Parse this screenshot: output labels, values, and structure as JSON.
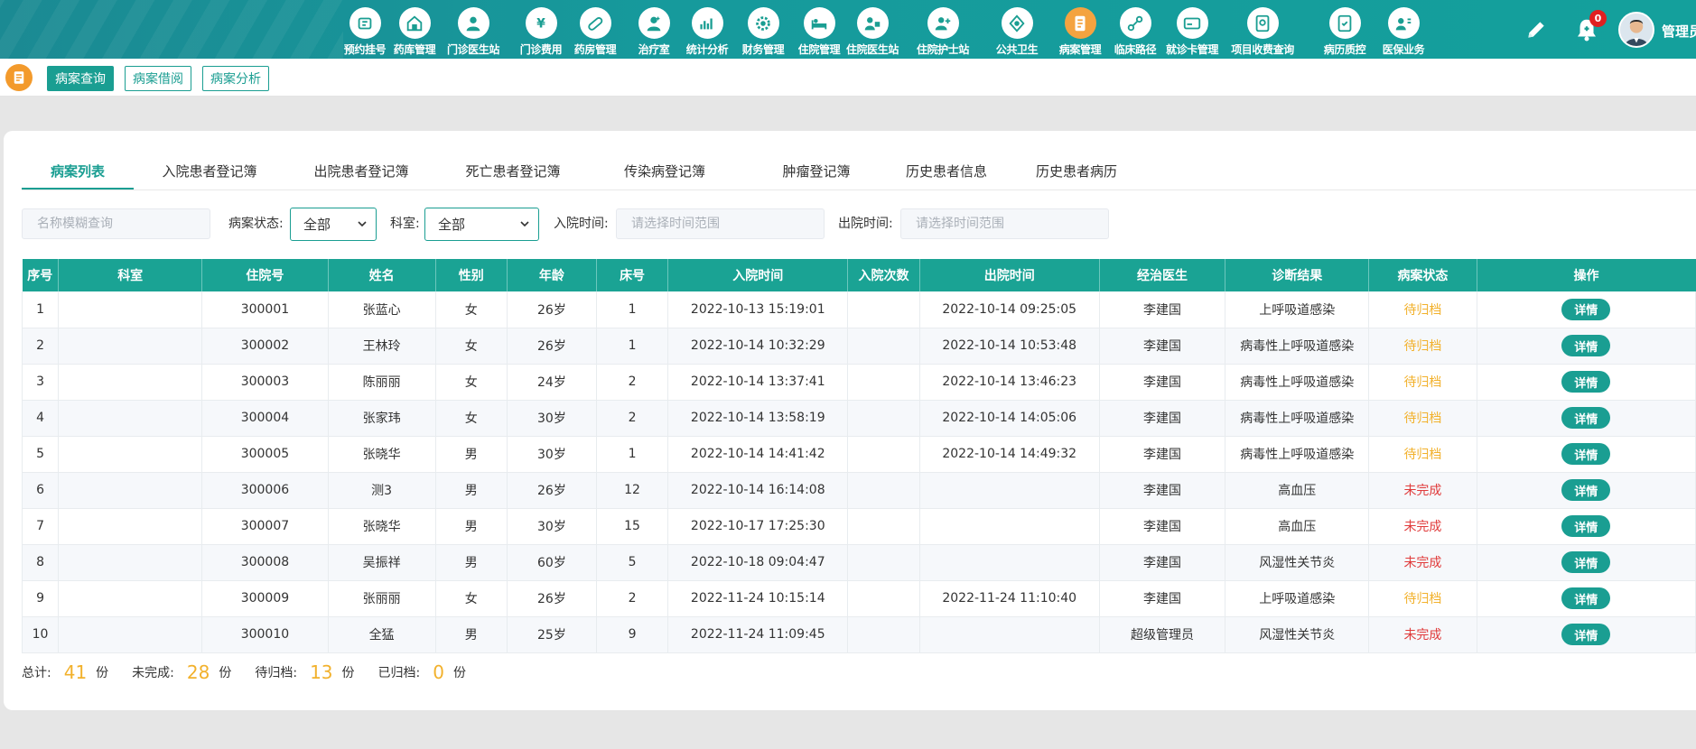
{
  "nav": {
    "items": [
      {
        "label": "预约挂号",
        "icon": "register-icon"
      },
      {
        "label": "药库管理",
        "icon": "warehouse-icon"
      },
      {
        "label": "门诊医生站",
        "icon": "doctor-icon"
      },
      {
        "label": "门诊费用",
        "icon": "yuan-icon"
      },
      {
        "label": "药房管理",
        "icon": "pill-icon"
      },
      {
        "label": "治疗室",
        "icon": "nurse-icon"
      },
      {
        "label": "统计分析",
        "icon": "chart-icon"
      },
      {
        "label": "财务管理",
        "icon": "finance-gear-icon"
      },
      {
        "label": "住院管理",
        "icon": "inpatient-icon"
      },
      {
        "label": "住院医生站",
        "icon": "inpatient-doctor-icon"
      },
      {
        "label": "住院护士站",
        "icon": "nurse-station-icon"
      },
      {
        "label": "公共卫生",
        "icon": "public-health-icon"
      },
      {
        "label": "病案管理",
        "icon": "medical-record-icon",
        "active": true
      },
      {
        "label": "临床路径",
        "icon": "clinical-path-icon"
      },
      {
        "label": "就诊卡管理",
        "icon": "card-icon"
      },
      {
        "label": "项目收费查询",
        "icon": "fee-query-icon"
      },
      {
        "label": "病历质控",
        "icon": "quality-control-icon"
      },
      {
        "label": "医保业务",
        "icon": "insurance-icon"
      }
    ],
    "notification_count": "0",
    "username": "管理员"
  },
  "subbar": {
    "tabs": [
      "病案查询",
      "病案借阅",
      "病案分析"
    ]
  },
  "tabs": [
    "病案列表",
    "入院患者登记簿",
    "出院患者登记簿",
    "死亡患者登记簿",
    "传染病登记簿",
    "肿瘤登记簿",
    "历史患者信息",
    "历史患者病历"
  ],
  "filters": {
    "name_placeholder": "名称模糊查询",
    "status_label": "病案状态:",
    "status_value": "全部",
    "dept_label": "科室:",
    "dept_value": "全部",
    "admit_label": "入院时间:",
    "admit_placeholder": "请选择时间范围",
    "discharge_label": "出院时间:",
    "discharge_placeholder": "请选择时间范围"
  },
  "table": {
    "headers": [
      "序号",
      "科室",
      "住院号",
      "姓名",
      "性别",
      "年龄",
      "床号",
      "入院时间",
      "入院次数",
      "出院时间",
      "经治医生",
      "诊断结果",
      "病案状态",
      "操作"
    ],
    "detail_label": "详情",
    "rows": [
      {
        "no": "1",
        "dept": "",
        "hosp_no": "300001",
        "name": "张蓝心",
        "gender": "女",
        "age": "26岁",
        "bed": "1",
        "admit": "2022-10-13 15:19:01",
        "times": "",
        "discharge": "2022-10-14 09:25:05",
        "doctor": "李建国",
        "diagnosis": "上呼吸道感染",
        "status": "待归档",
        "status_type": "pending"
      },
      {
        "no": "2",
        "dept": "",
        "hosp_no": "300002",
        "name": "王林玲",
        "gender": "女",
        "age": "26岁",
        "bed": "1",
        "admit": "2022-10-14 10:32:29",
        "times": "",
        "discharge": "2022-10-14 10:53:48",
        "doctor": "李建国",
        "diagnosis": "病毒性上呼吸道感染",
        "status": "待归档",
        "status_type": "pending"
      },
      {
        "no": "3",
        "dept": "",
        "hosp_no": "300003",
        "name": "陈丽丽",
        "gender": "女",
        "age": "24岁",
        "bed": "2",
        "admit": "2022-10-14 13:37:41",
        "times": "",
        "discharge": "2022-10-14 13:46:23",
        "doctor": "李建国",
        "diagnosis": "病毒性上呼吸道感染",
        "status": "待归档",
        "status_type": "pending"
      },
      {
        "no": "4",
        "dept": "",
        "hosp_no": "300004",
        "name": "张家玮",
        "gender": "女",
        "age": "30岁",
        "bed": "2",
        "admit": "2022-10-14 13:58:19",
        "times": "",
        "discharge": "2022-10-14 14:05:06",
        "doctor": "李建国",
        "diagnosis": "病毒性上呼吸道感染",
        "status": "待归档",
        "status_type": "pending"
      },
      {
        "no": "5",
        "dept": "",
        "hosp_no": "300005",
        "name": "张晓华",
        "gender": "男",
        "age": "30岁",
        "bed": "1",
        "admit": "2022-10-14 14:41:42",
        "times": "",
        "discharge": "2022-10-14 14:49:32",
        "doctor": "李建国",
        "diagnosis": "病毒性上呼吸道感染",
        "status": "待归档",
        "status_type": "pending"
      },
      {
        "no": "6",
        "dept": "",
        "hosp_no": "300006",
        "name": "测3",
        "gender": "男",
        "age": "26岁",
        "bed": "12",
        "admit": "2022-10-14 16:14:08",
        "times": "",
        "discharge": "",
        "doctor": "李建国",
        "diagnosis": "高血压",
        "status": "未完成",
        "status_type": "incomplete"
      },
      {
        "no": "7",
        "dept": "",
        "hosp_no": "300007",
        "name": "张晓华",
        "gender": "男",
        "age": "30岁",
        "bed": "15",
        "admit": "2022-10-17 17:25:30",
        "times": "",
        "discharge": "",
        "doctor": "李建国",
        "diagnosis": "高血压",
        "status": "未完成",
        "status_type": "incomplete"
      },
      {
        "no": "8",
        "dept": "",
        "hosp_no": "300008",
        "name": "吴振祥",
        "gender": "男",
        "age": "60岁",
        "bed": "5",
        "admit": "2022-10-18 09:04:47",
        "times": "",
        "discharge": "",
        "doctor": "李建国",
        "diagnosis": "风湿性关节炎",
        "status": "未完成",
        "status_type": "incomplete"
      },
      {
        "no": "9",
        "dept": "",
        "hosp_no": "300009",
        "name": "张丽丽",
        "gender": "女",
        "age": "26岁",
        "bed": "2",
        "admit": "2022-11-24 10:15:14",
        "times": "",
        "discharge": "2022-11-24 11:10:40",
        "doctor": "李建国",
        "diagnosis": "上呼吸道感染",
        "status": "待归档",
        "status_type": "pending"
      },
      {
        "no": "10",
        "dept": "",
        "hosp_no": "300010",
        "name": "全猛",
        "gender": "男",
        "age": "25岁",
        "bed": "9",
        "admit": "2022-11-24 11:09:45",
        "times": "",
        "discharge": "",
        "doctor": "超级管理员",
        "diagnosis": "风湿性关节炎",
        "status": "未完成",
        "status_type": "incomplete"
      }
    ]
  },
  "summary": {
    "total_label": "总计:",
    "total": "41",
    "incomplete_label": "未完成:",
    "incomplete": "28",
    "pending_label": "待归档:",
    "pending": "13",
    "archived_label": "已归档:",
    "archived": "0",
    "unit": "份"
  },
  "colors": {
    "accent": "#1a9e92",
    "header_bg": "#1aa394",
    "pending": "#f2b12c",
    "incomplete": "#e03b3b",
    "active_module": "#f4a340"
  }
}
